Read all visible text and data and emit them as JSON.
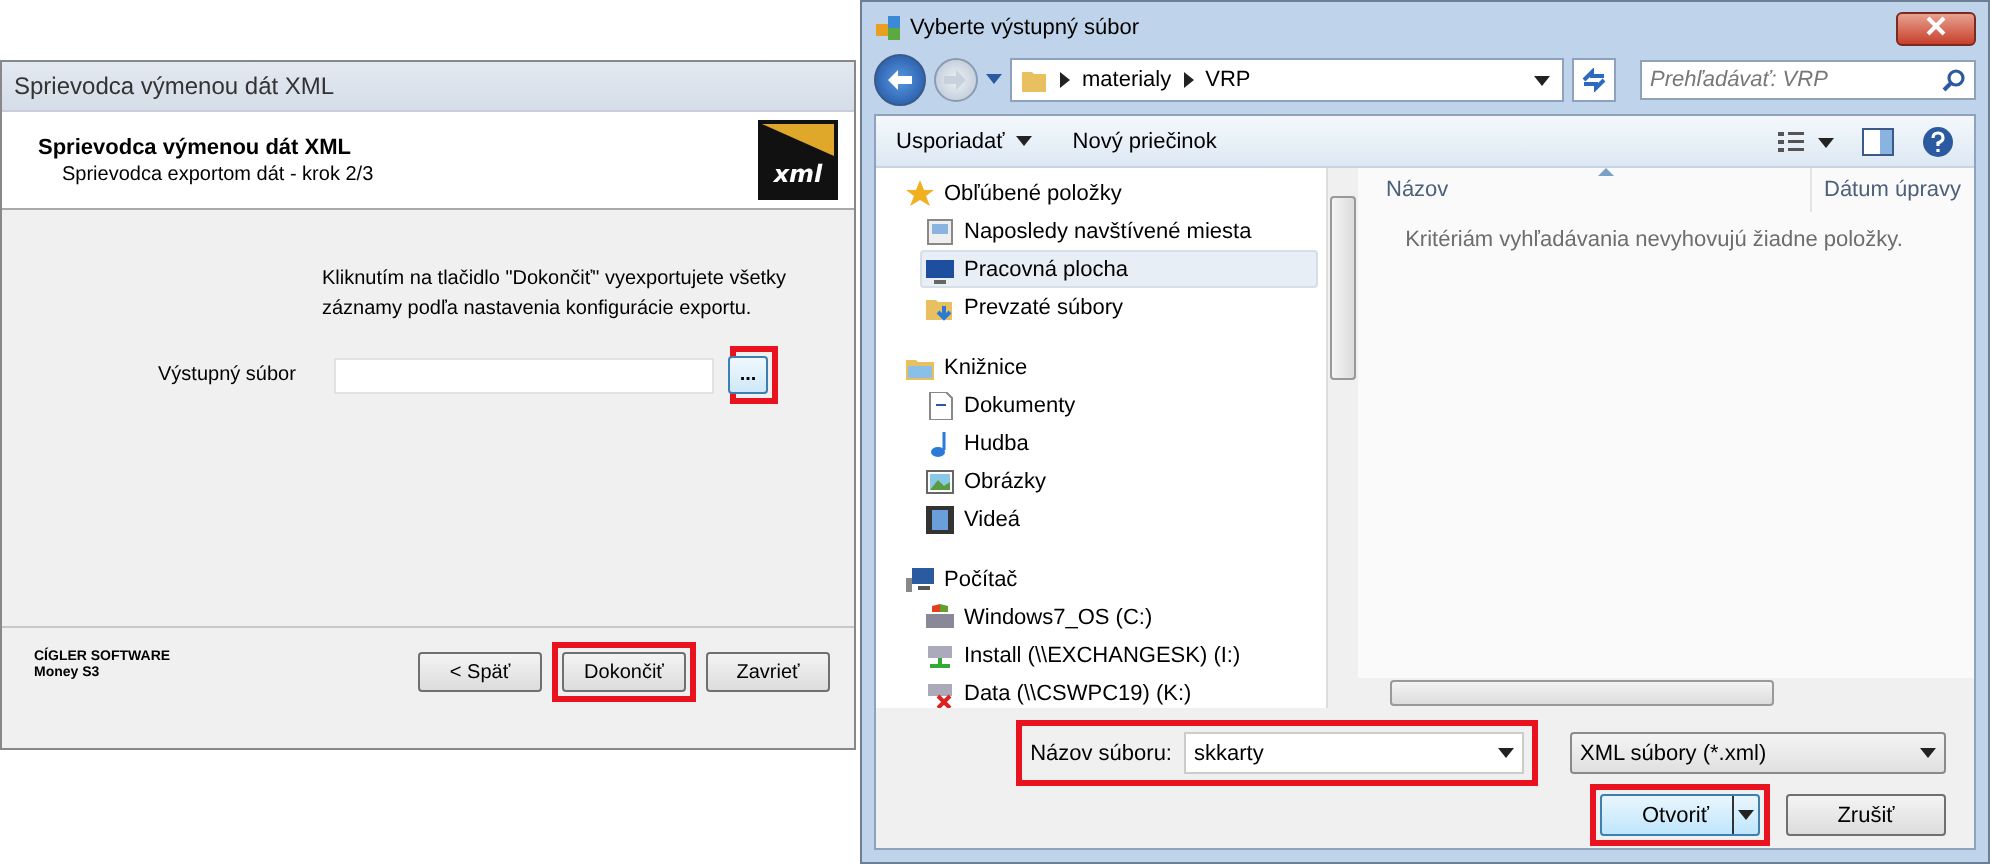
{
  "wizard": {
    "title": "Sprievodca výmenou dát XML",
    "header_title": "Sprievodca výmenou dát XML",
    "header_subtitle": "Sprievodca exportom dát - krok 2/3",
    "logo_text": "xml",
    "instruction": "Kliknutím na tlačidlo \"Dokončiť\" vyexportujete všetky záznamy podľa nastavenia konfigurácie exportu.",
    "output_label": "Výstupný súbor",
    "browse_button": {
      "label": "...",
      "highlighted": true
    },
    "company": "CÍGLER SOFTWARE",
    "product": "Money S3",
    "buttons": [
      {
        "label": "< Späť",
        "highlighted": false
      },
      {
        "label": "Dokončiť",
        "highlighted": true
      },
      {
        "label": "Zavrieť",
        "highlighted": false
      }
    ]
  },
  "file_dialog": {
    "title": "Vyberte výstupný súbor",
    "path": [
      "materialy",
      "VRP"
    ],
    "search": {
      "placeholder": "Prehľadávať: VRP"
    },
    "toolbar": [
      "Usporiadať",
      "Nový priečinok"
    ],
    "tree": [
      {
        "label": "Obľúbené položky",
        "selected": false,
        "children": [
          {
            "label": "Naposledy navštívené miesta",
            "selected": false
          },
          {
            "label": "Pracovná plocha",
            "selected": true
          },
          {
            "label": "Prevzaté súbory",
            "selected": false
          }
        ]
      },
      {
        "label": "Knižnice",
        "selected": false,
        "children": [
          {
            "label": "Dokumenty",
            "selected": false
          },
          {
            "label": "Hudba",
            "selected": false
          },
          {
            "label": "Obrázky",
            "selected": false
          },
          {
            "label": "Videá",
            "selected": false
          }
        ]
      },
      {
        "label": "Počítač",
        "selected": false,
        "children": [
          {
            "label": "Windows7_OS (C:)",
            "selected": false
          },
          {
            "label": "Install (\\\\EXCHANGESK) (I:)",
            "selected": false
          },
          {
            "label": "Data (\\\\CSWPC19) (K:)",
            "selected": false
          }
        ]
      }
    ],
    "columns": [
      {
        "label": "Názov",
        "sorted": true
      },
      {
        "label": "Dátum úpravy",
        "sorted": false
      }
    ],
    "empty_message": "Kritériám vyhľadávania nevyhovujú žiadne položky.",
    "filename": {
      "label": "Názov súboru:",
      "value": "skkarty",
      "highlighted": true
    },
    "filter": "XML súbory (*.xml)",
    "buttons": [
      {
        "label": "Otvoriť",
        "kind": "split",
        "highlighted": true
      },
      {
        "label": "Zrušiť",
        "kind": "plain",
        "highlighted": false
      }
    ]
  }
}
